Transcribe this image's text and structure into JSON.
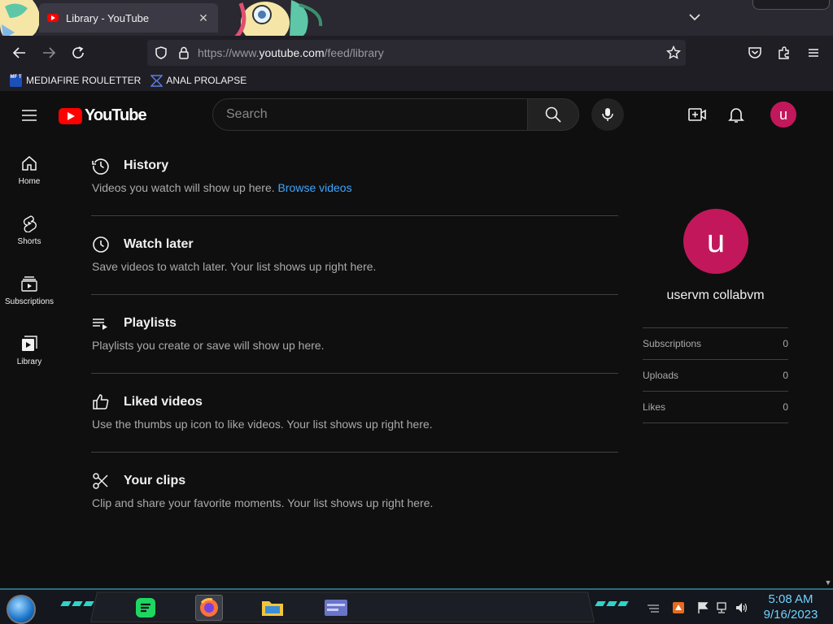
{
  "browser": {
    "tab_title": "Library - YouTube",
    "tab_close": "✕",
    "url_prefix": "https://www.",
    "url_domain": "youtube.com",
    "url_path": "/feed/library",
    "bookmarks": [
      {
        "label": "MEDIAFIRE ROULETTER",
        "icon": "mediafire-icon",
        "icon_text": "MF T"
      },
      {
        "label": "ANAL PROLAPSE",
        "icon": "sigma-icon"
      }
    ]
  },
  "youtube": {
    "logo_text": "YouTube",
    "search_placeholder": "Search",
    "avatar_letter": "u",
    "sidebar": [
      {
        "label": "Home",
        "icon": "home-icon"
      },
      {
        "label": "Shorts",
        "icon": "shorts-icon"
      },
      {
        "label": "Subscriptions",
        "icon": "subscriptions-icon"
      },
      {
        "label": "Library",
        "icon": "library-icon"
      }
    ],
    "sections": [
      {
        "title": "History",
        "description": "Videos you watch will show up here.",
        "link": "Browse videos",
        "icon": "history-icon"
      },
      {
        "title": "Watch later",
        "description": "Save videos to watch later. Your list shows up right here.",
        "icon": "watch-later-icon"
      },
      {
        "title": "Playlists",
        "description": "Playlists you create or save will show up here.",
        "icon": "playlists-icon"
      },
      {
        "title": "Liked videos",
        "description": "Use the thumbs up icon to like videos. Your list shows up right here.",
        "icon": "like-icon"
      },
      {
        "title": "Your clips",
        "description": "Clip and share your favorite moments. Your list shows up right here.",
        "icon": "clips-icon"
      }
    ],
    "profile": {
      "avatar_letter": "u",
      "name": "uservm collabvm",
      "stats": [
        {
          "label": "Subscriptions",
          "value": "0"
        },
        {
          "label": "Uploads",
          "value": "0"
        },
        {
          "label": "Likes",
          "value": "0"
        }
      ]
    }
  },
  "taskbar": {
    "time": "5:08 AM",
    "date": "9/16/2023"
  },
  "colors": {
    "background": "#0f0f0f",
    "brand_red": "#ff0000",
    "link_blue": "#3ea6ff",
    "avatar": "#c2185b",
    "clock": "#6fd3ff"
  }
}
